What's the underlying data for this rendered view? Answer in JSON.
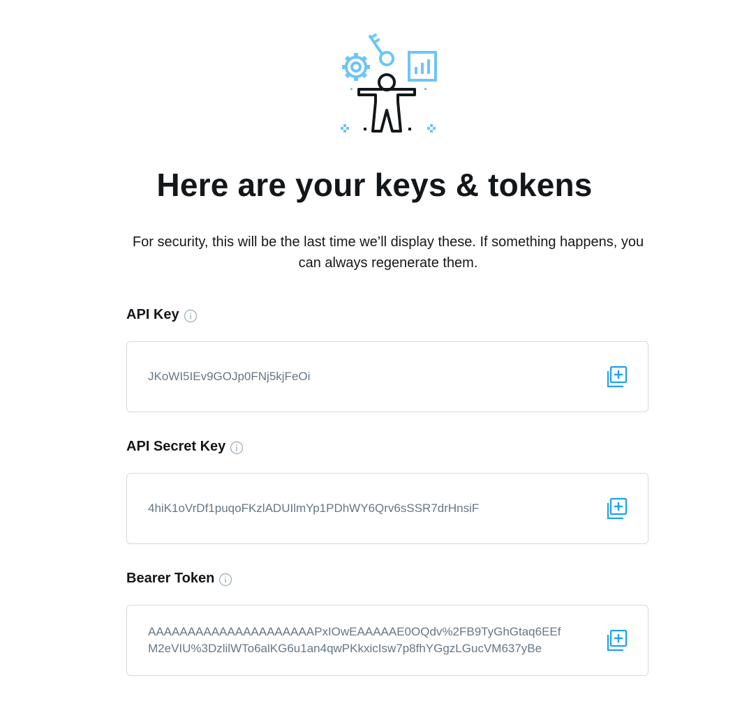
{
  "page": {
    "title": "Here are your keys & tokens",
    "subtitle": "For security, this will be the last time we’ll display these. If something happens, you can always regenerate them."
  },
  "colors": {
    "accent": "#1da1f2",
    "illustration_blue": "#6dc5f5",
    "text": "#14171a",
    "muted": "#657786",
    "border": "#d6d9dc"
  },
  "fields": [
    {
      "label": "API Key",
      "value": "JKoWI5IEv9GOJp0FNj5kjFeOi",
      "info_icon": "info-icon",
      "copy_icon": "copy-icon"
    },
    {
      "label": "API Secret Key",
      "value": "4hiK1oVrDf1puqoFKzlADUIlmYp1PDhWY6Qrv6sSSR7drHnsiF",
      "info_icon": "info-icon",
      "copy_icon": "copy-icon"
    },
    {
      "label": "Bearer Token",
      "value": "AAAAAAAAAAAAAAAAAAAAAPxIOwEAAAAAE0OQdv%2FB9TyGhGtaq6EEfM2eVIU%3DzlilWTo6alKG6u1an4qwPKkxicIsw7p8fhYGgzLGucVM637yBe",
      "info_icon": "info-icon",
      "copy_icon": "copy-icon"
    }
  ]
}
